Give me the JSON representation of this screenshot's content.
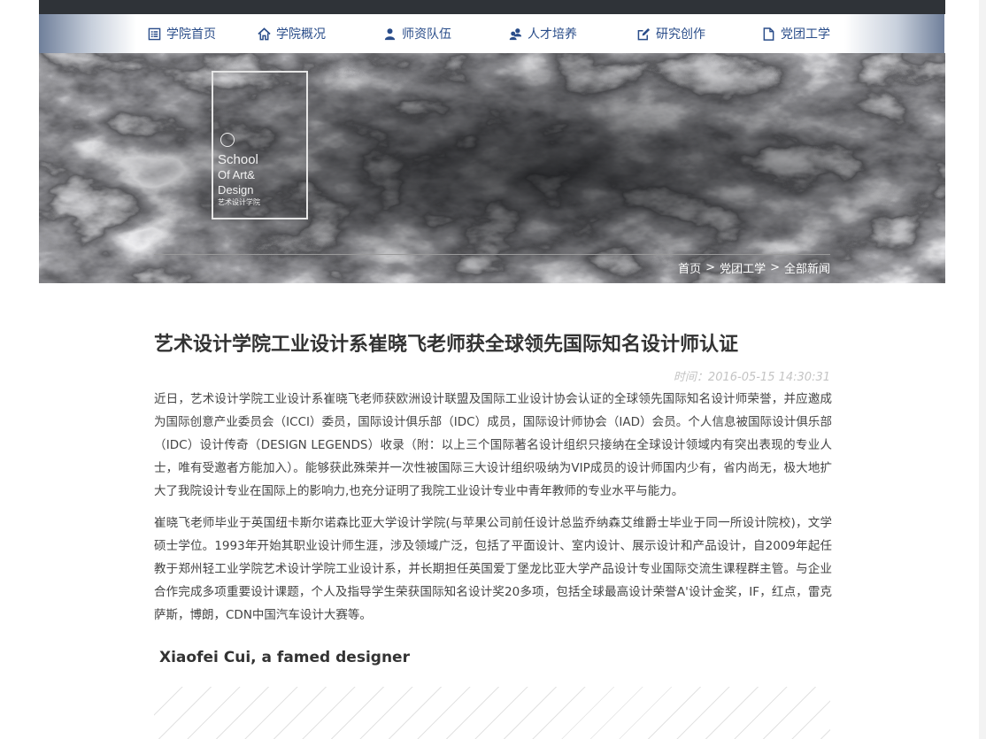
{
  "nav": {
    "items": [
      {
        "label": "学院首页",
        "icon": "list-icon"
      },
      {
        "label": "学院概况",
        "icon": "home-icon"
      },
      {
        "label": "师资队伍",
        "icon": "user-icon"
      },
      {
        "label": "人才培养",
        "icon": "users-icon"
      },
      {
        "label": "研究创作",
        "icon": "edit-icon"
      },
      {
        "label": "党团工学",
        "icon": "document-icon"
      }
    ]
  },
  "banner": {
    "logo_line1": "School",
    "logo_line2": "Of Art&",
    "logo_line3": "Design",
    "logo_sub": "艺术设计学院"
  },
  "breadcrumb": {
    "home": "首页",
    "section": "党团工学",
    "current": "全部新闻",
    "separator": ">"
  },
  "article": {
    "title": "艺术设计学院工业设计系崔晓飞老师获全球领先国际知名设计师认证",
    "time": "时间：2016-05-15 14:30:31",
    "paragraph1": "近日，艺术设计学院工业设计系崔晓飞老师获欧洲设计联盟及国际工业设计协会认证的全球领先国际知名设计师荣誉，并应邀成为国际创意产业委员会（ICCI）委员，国际设计俱乐部（IDC）成员，国际设计师协会（IAD）会员。个人信息被国际设计俱乐部（IDC）设计传奇（DESIGN LEGENDS）收录（附：以上三个国际著名设计组织只接纳在全球设计领域内有突出表现的专业人士，唯有受邀者方能加入）。能够获此殊荣并一次性被国际三大设计组织吸纳为VIP成员的设计师国内少有，省内尚无，极大地扩大了我院设计专业在国际上的影响力,也充分证明了我院工业设计专业中青年教师的专业水平与能力。",
    "paragraph2": "崔晓飞老师毕业于英国纽卡斯尔诺森比亚大学设计学院(与苹果公司前任设计总监乔纳森艾维爵士毕业于同一所设计院校)，文学硕士学位。1993年开始其职业设计师生涯，涉及领域广泛，包括了平面设计、室内设计、展示设计和产品设计，自2009年起任教于郑州轻工业学院艺术设计学院工业设计系，并长期担任英国爱丁堡龙比亚大学产品设计专业国际交流生课程群主管。与企业合作完成多项重要设计课题，个人及指导学生荣获国际知名设计奖20多项，包括全球最高设计荣誉A'设计金奖，IF，红点，雷克萨斯，博朗，CDN中国汽车设计大赛等。",
    "image_caption": "Xiaofei Cui, a famed designer"
  },
  "colors": {
    "nav_text": "#2a4d8a",
    "title": "#333333",
    "meta": "#c4c4c4",
    "body_text": "#444444"
  }
}
